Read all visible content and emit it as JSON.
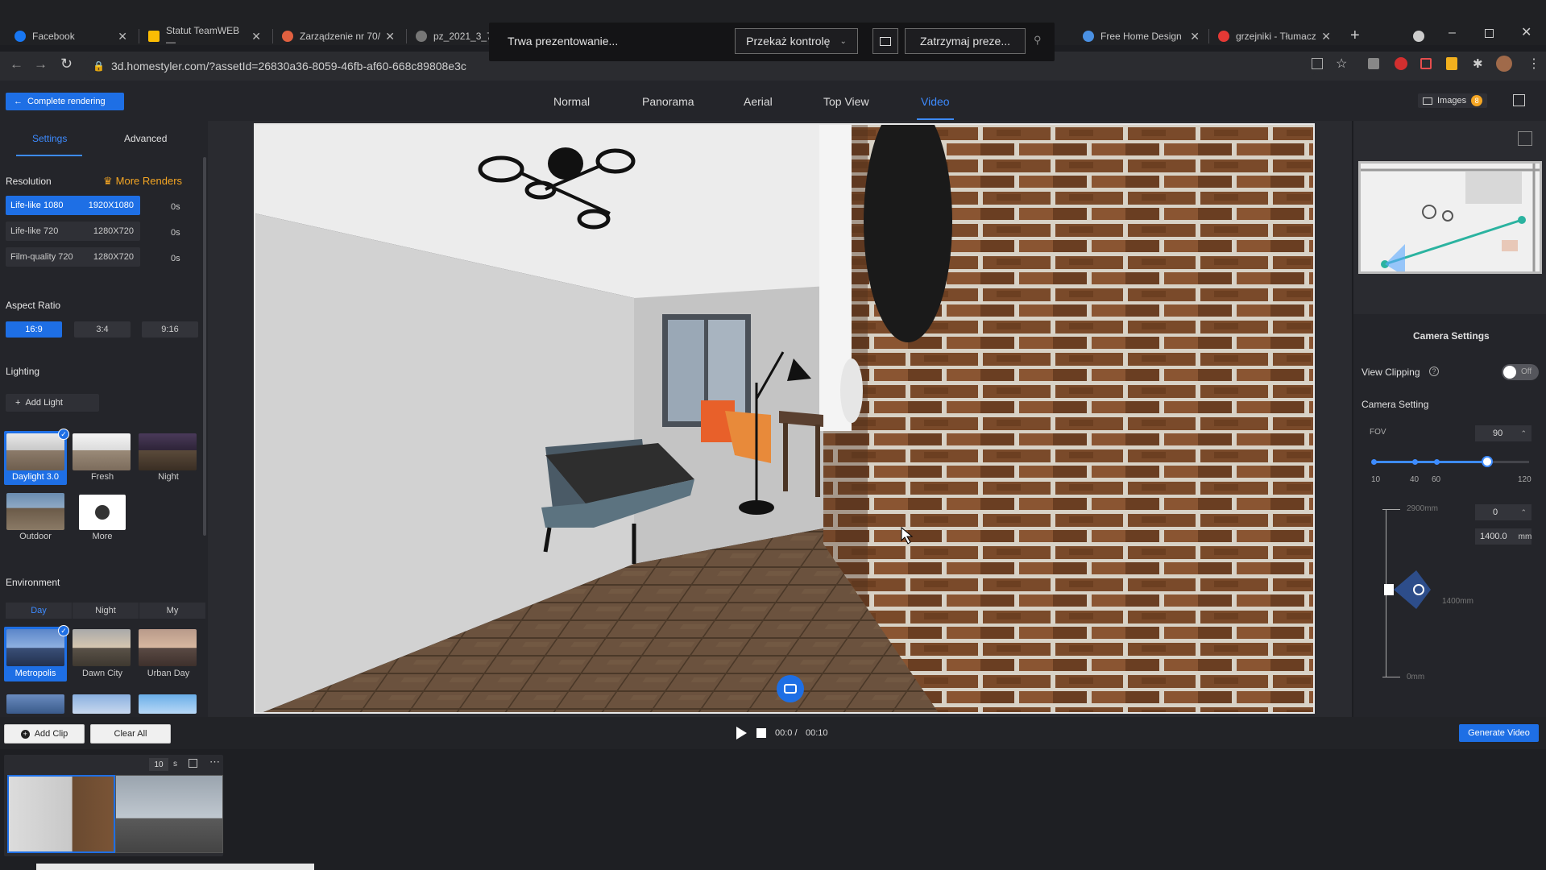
{
  "browser": {
    "tabs": [
      {
        "label": "Facebook",
        "color": "#1877f2"
      },
      {
        "label": "Statut TeamWEB —",
        "color": "#fbbc04"
      },
      {
        "label": "Zarządzenie nr 70/",
        "color": "#e06040"
      },
      {
        "label": "pz_2021_3_7(",
        "color": "#aaaaaa"
      },
      {
        "label": "Free Home Design",
        "color": "#4a90e2"
      },
      {
        "label": "grzejniki - Tłumacz",
        "color": "#e53935"
      }
    ],
    "new_tab": "+",
    "url": "3d.homestyler.com/?assetId=26830a36-8059-46fb-af60-668c89808e3c"
  },
  "presentation": {
    "status": "Trwa prezentowanie...",
    "pass_control": "Przekaż kontrolę",
    "stop": "Zatrzymaj preze..."
  },
  "header": {
    "complete_rendering": "Complete rendering",
    "view_tabs": [
      "Normal",
      "Panorama",
      "Aerial",
      "Top View",
      "Video"
    ],
    "active_view": "Video",
    "images_label": "Images",
    "images_count": "8"
  },
  "left": {
    "tabs": [
      "Settings",
      "Advanced"
    ],
    "resolution_title": "Resolution",
    "more_renders": "More Renders",
    "resolutions": [
      {
        "name": "Life-like 1080",
        "size": "1920X1080",
        "time": "0s"
      },
      {
        "name": "Life-like 720",
        "size": "1280X720",
        "time": "0s"
      },
      {
        "name": "Film-quality 720",
        "size": "1280X720",
        "time": "0s"
      }
    ],
    "aspect_title": "Aspect Ratio",
    "aspects": [
      "16:9",
      "3:4",
      "9:16"
    ],
    "lighting_title": "Lighting",
    "add_light": "Add Light",
    "lights": [
      "Daylight 3.0",
      "Fresh",
      "Night",
      "Outdoor",
      "More"
    ],
    "environment_title": "Environment",
    "env_tabs": [
      "Day",
      "Night",
      "My"
    ],
    "environments": [
      "Metropolis",
      "Dawn City",
      "Urban Day"
    ]
  },
  "right": {
    "camera_settings": "Camera Settings",
    "view_clipping": "View Clipping",
    "clipping_state": "Off",
    "camera_setting": "Camera Setting",
    "fov_label": "FOV",
    "fov_value": "90",
    "fov_ticks": [
      "10",
      "40",
      "60",
      "120"
    ],
    "height_top": "2900mm",
    "height_mid": "1400mm",
    "height_bottom": "0mm",
    "angle_value": "0",
    "height_value": "1400.0",
    "height_unit": "mm"
  },
  "bottom": {
    "add_clip": "Add Clip",
    "clear_all": "Clear All",
    "time_current": "00:0 /",
    "time_total": "00:10",
    "generate_video": "Generate Video",
    "clip_duration": "10",
    "clip_unit": "s"
  }
}
